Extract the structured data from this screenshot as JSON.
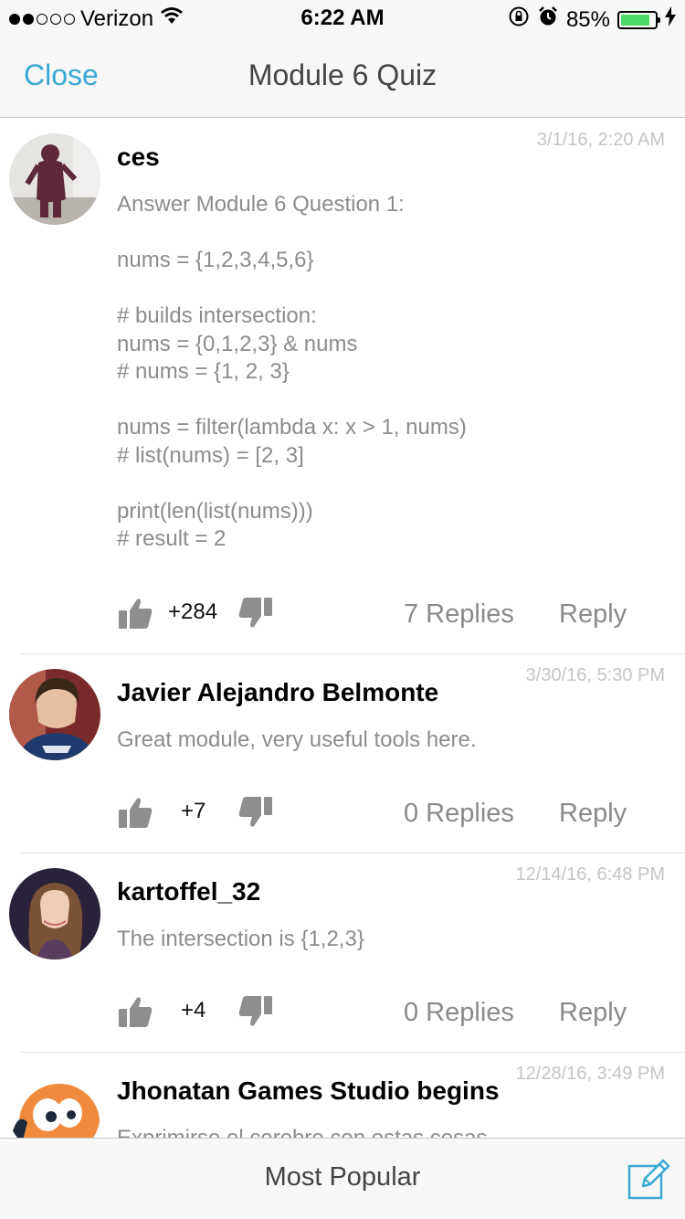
{
  "status_bar": {
    "carrier": "Verizon",
    "time": "6:22 AM",
    "battery_percent": "85%",
    "battery_level": 0.85,
    "icons": [
      "signal-dots-icon",
      "wifi-icon",
      "rotation-lock-icon",
      "alarm-icon",
      "battery-icon",
      "charging-bolt-icon"
    ]
  },
  "nav": {
    "close_label": "Close",
    "title": "Module 6 Quiz"
  },
  "posts": [
    {
      "author": "ces",
      "timestamp": "3/1/16, 2:20 AM",
      "body": "Answer Module 6 Question 1:\n\nnums = {1,2,3,4,5,6}\n\n# builds intersection:\nnums = {0,1,2,3} & nums\n# nums = {1, 2, 3}\n\nnums = filter(lambda x: x > 1, nums)\n# list(nums) = [2, 3]\n\nprint(len(list(nums)))\n# result = 2",
      "votes": "+284",
      "replies": "7 Replies",
      "reply_label": "Reply"
    },
    {
      "author": "Javier Alejandro Belmonte",
      "timestamp": "3/30/16, 5:30 PM",
      "body": "Great module, very useful tools here.",
      "votes": "+7",
      "replies": "0 Replies",
      "reply_label": "Reply"
    },
    {
      "author": "kartoffel_32",
      "timestamp": "12/14/16, 6:48 PM",
      "body": "The intersection is {1,2,3}",
      "votes": "+4",
      "replies": "0 Replies",
      "reply_label": "Reply"
    },
    {
      "author": "Jhonatan Games Studio begins",
      "timestamp": "12/28/16, 3:49 PM",
      "body": "Exprimirse el cerebro con estas cosas",
      "votes": "",
      "replies": "",
      "reply_label": ""
    }
  ],
  "toolbar": {
    "sort_label": "Most Popular",
    "compose_icon": "compose-icon"
  },
  "colors": {
    "accent": "#3aa9d6",
    "bar_bg": "#f7f7f7",
    "meta_gray": "#8a8a8a",
    "battery_green": "#4cd964"
  }
}
